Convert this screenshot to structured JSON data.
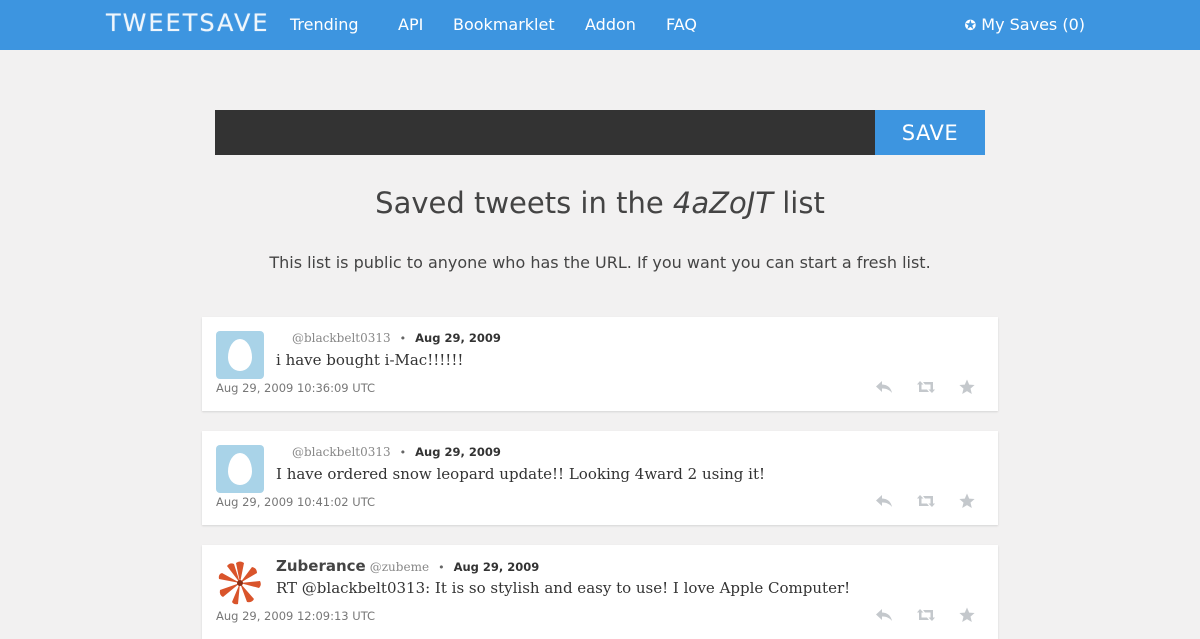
{
  "nav": {
    "brand": "TWEETSAVE",
    "links": [
      "Trending",
      "API",
      "Bookmarklet",
      "Addon",
      "FAQ"
    ],
    "my_saves": "My Saves (0)",
    "my_saves_icon": "gear-star-icon"
  },
  "search": {
    "value": "",
    "placeholder": "",
    "button_label": "SAVE"
  },
  "heading": {
    "prefix": "Saved tweets in the ",
    "list_id": "4aZoJT",
    "suffix": " list"
  },
  "subtitle": "This list is public to anyone who has the URL. If you want you can start a fresh list.",
  "colors": {
    "brand_blue": "#3d95e0",
    "input_dark": "#333333",
    "page_bg": "#f2f1f1"
  },
  "tweets": [
    {
      "name": "",
      "handle": "@blackbelt0313",
      "date": "Aug 29, 2009",
      "text": "i have bought i-Mac!!!!!!",
      "timestamp": "Aug 29, 2009 10:36:09 UTC",
      "avatar": "egg-avatar"
    },
    {
      "name": "",
      "handle": "@blackbelt0313",
      "date": "Aug 29, 2009",
      "text": "I have ordered snow leopard update!! Looking 4ward 2 using it!",
      "timestamp": "Aug 29, 2009 10:41:02 UTC",
      "avatar": "egg-avatar"
    },
    {
      "name": "Zuberance",
      "handle": "@zubeme",
      "date": "Aug 29, 2009",
      "text": "RT @blackbelt0313: It is so stylish and easy to use! I love Apple Computer!",
      "timestamp": "Aug 29, 2009 12:09:13 UTC",
      "avatar": "pinwheel-avatar"
    }
  ],
  "separator": "•",
  "actions": [
    "reply-icon",
    "retweet-icon",
    "favorite-icon"
  ]
}
